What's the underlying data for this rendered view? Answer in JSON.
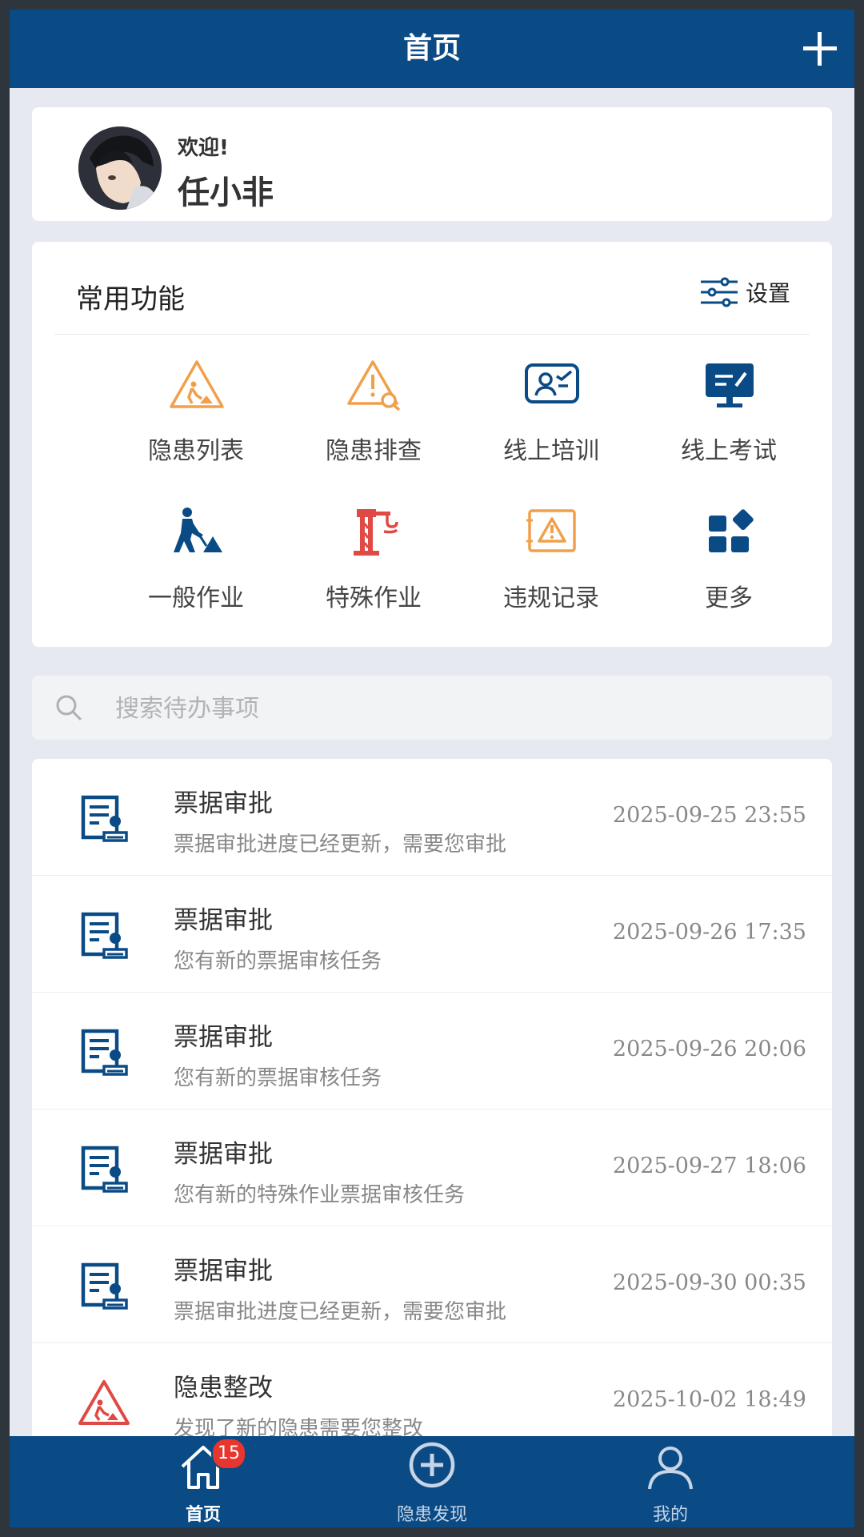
{
  "header": {
    "title": "首页"
  },
  "welcome": {
    "greeting": "欢迎!",
    "name": "任小非"
  },
  "functions": {
    "title": "常用功能",
    "settings_label": "设置",
    "items": [
      {
        "label": "隐患列表",
        "icon": "warning-worker-icon"
      },
      {
        "label": "隐患排查",
        "icon": "warning-search-icon"
      },
      {
        "label": "线上培训",
        "icon": "training-icon"
      },
      {
        "label": "线上考试",
        "icon": "exam-monitor-icon"
      },
      {
        "label": "一般作业",
        "icon": "worker-shovel-icon"
      },
      {
        "label": "特殊作业",
        "icon": "crane-icon"
      },
      {
        "label": "违规记录",
        "icon": "violation-icon"
      },
      {
        "label": "更多",
        "icon": "more-grid-icon"
      }
    ]
  },
  "search": {
    "placeholder": "搜索待办事项"
  },
  "todos": [
    {
      "title": "票据审批",
      "subtitle": "票据审批进度已经更新，需要您审批",
      "time": "2025-09-25 23:55",
      "icon": "document-approval-icon"
    },
    {
      "title": "票据审批",
      "subtitle": "您有新的票据审核任务",
      "time": "2025-09-26 17:35",
      "icon": "document-approval-icon"
    },
    {
      "title": "票据审批",
      "subtitle": "您有新的票据审核任务",
      "time": "2025-09-26 20:06",
      "icon": "document-approval-icon"
    },
    {
      "title": "票据审批",
      "subtitle": "您有新的特殊作业票据审核任务",
      "time": "2025-09-27 18:06",
      "icon": "document-approval-icon"
    },
    {
      "title": "票据审批",
      "subtitle": "票据审批进度已经更新，需要您审批",
      "time": "2025-09-30 00:35",
      "icon": "document-approval-icon"
    },
    {
      "title": "隐患整改",
      "subtitle": "发现了新的隐患需要您整改",
      "time": "2025-10-02 18:49",
      "icon": "hazard-warning-icon"
    }
  ],
  "tabbar": [
    {
      "label": "首页",
      "icon": "home-icon",
      "badge": "15"
    },
    {
      "label": "隐患发现",
      "icon": "plus-circle-icon"
    },
    {
      "label": "我的",
      "icon": "user-icon"
    }
  ],
  "colors": {
    "primary": "#0a4b86",
    "orange": "#f0a04b",
    "red": "#e04a45",
    "badge": "#e8352d"
  }
}
